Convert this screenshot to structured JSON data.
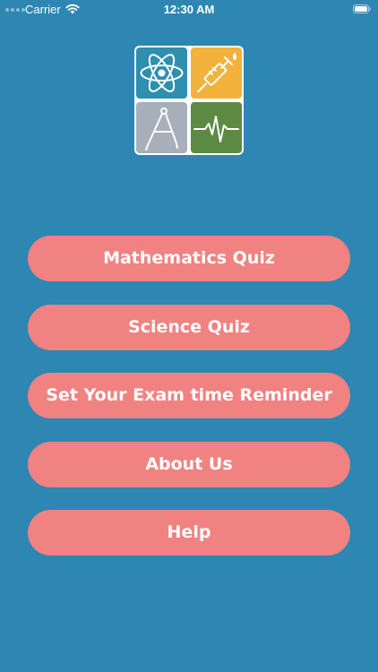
{
  "status_bar": {
    "carrier": "Carrier",
    "time": "12:30 AM"
  },
  "logo": {
    "tiles": [
      {
        "icon": "atom-icon",
        "color": "#2e8fae"
      },
      {
        "icon": "syringe-icon",
        "color": "#f2b23b"
      },
      {
        "icon": "compass-icon",
        "color": "#a7b0ba"
      },
      {
        "icon": "heartbeat-icon",
        "color": "#5c8a43"
      }
    ]
  },
  "menu": {
    "items": [
      {
        "label": "Mathematics Quiz"
      },
      {
        "label": "Science Quiz"
      },
      {
        "label": "Set Your Exam time Reminder"
      },
      {
        "label": "About Us"
      },
      {
        "label": "Help"
      }
    ]
  },
  "colors": {
    "background": "#2e86b3",
    "button": "#f08281",
    "button_text": "#ffffff"
  }
}
